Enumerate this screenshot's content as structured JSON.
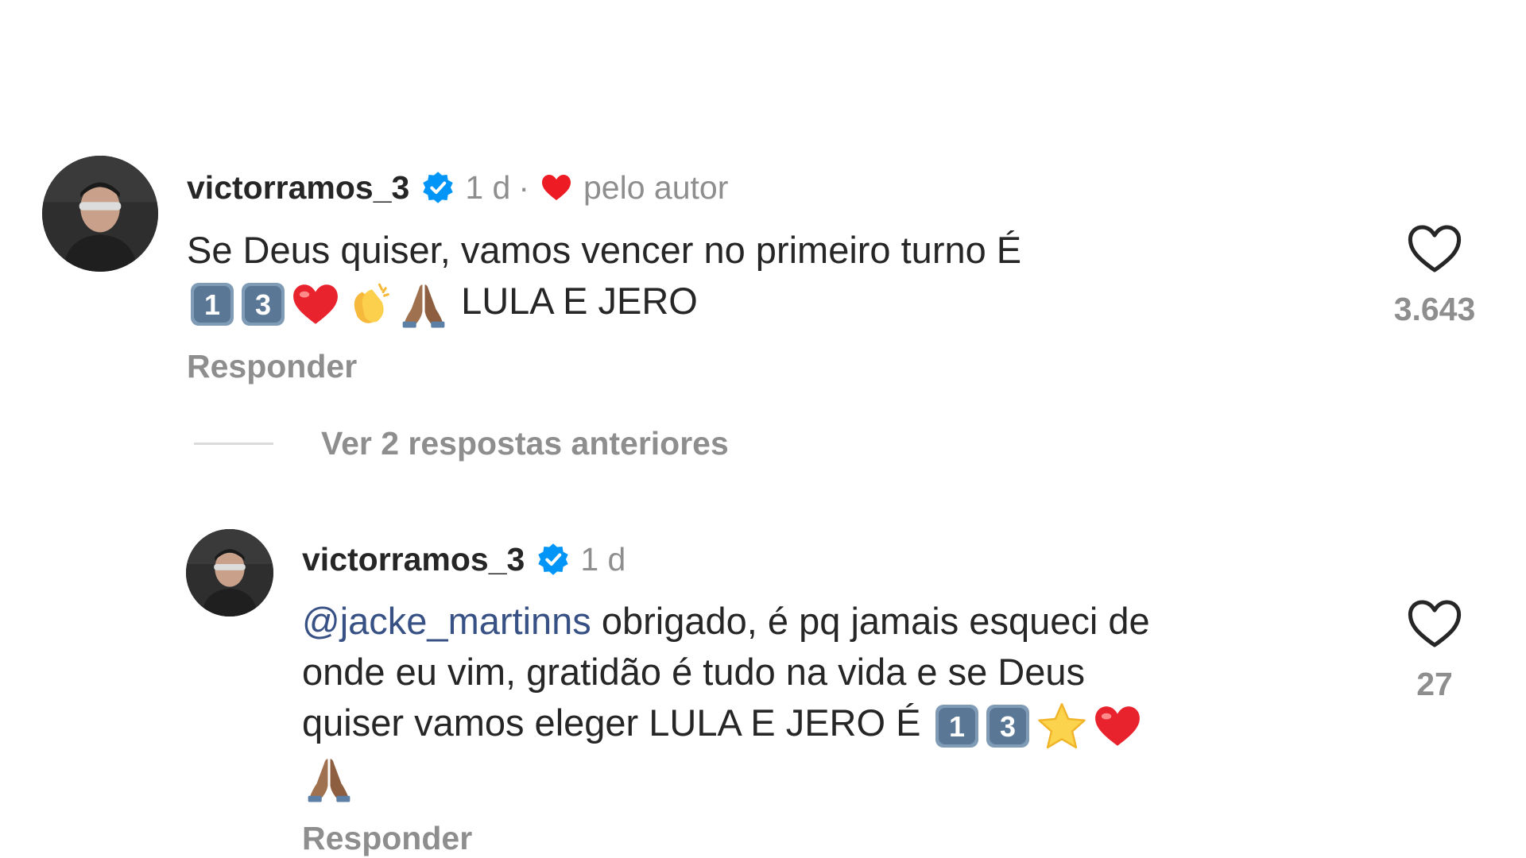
{
  "comment": {
    "username": "victorramos_3",
    "time": "1 d",
    "separator": "·",
    "liked_by_author": "pelo autor",
    "text_line1": "Se Deus quiser, vamos vencer no  primeiro turno É",
    "text_line2": "LULA E JERO",
    "line2_emojis": [
      "keycap-1",
      "keycap-3",
      "red-heart",
      "clapping-hands",
      "folded-hands"
    ],
    "reply_label": "Responder",
    "like_count": "3.643"
  },
  "view_replies": {
    "label": "Ver 2 respostas anteriores"
  },
  "reply": {
    "username": "victorramos_3",
    "time": "1 d",
    "mention": "@jacke_martinns",
    "text_line1_rest": "obrigado, é pq jamais esqueci de",
    "text_line2": "onde eu vim, gratidão é tudo na vida e se Deus",
    "text_line3": "quiser vamos eleger LULA E JERO É",
    "line3_emojis": [
      "keycap-1",
      "keycap-3",
      "star",
      "red-heart"
    ],
    "line4_emojis": [
      "folded-hands"
    ],
    "reply_label": "Responder",
    "like_count": "27"
  },
  "colors": {
    "text": "#262626",
    "muted": "#8e8e8e",
    "mention": "#385185",
    "verified_badge": "#0095f6",
    "heart_red": "#ed4956"
  }
}
